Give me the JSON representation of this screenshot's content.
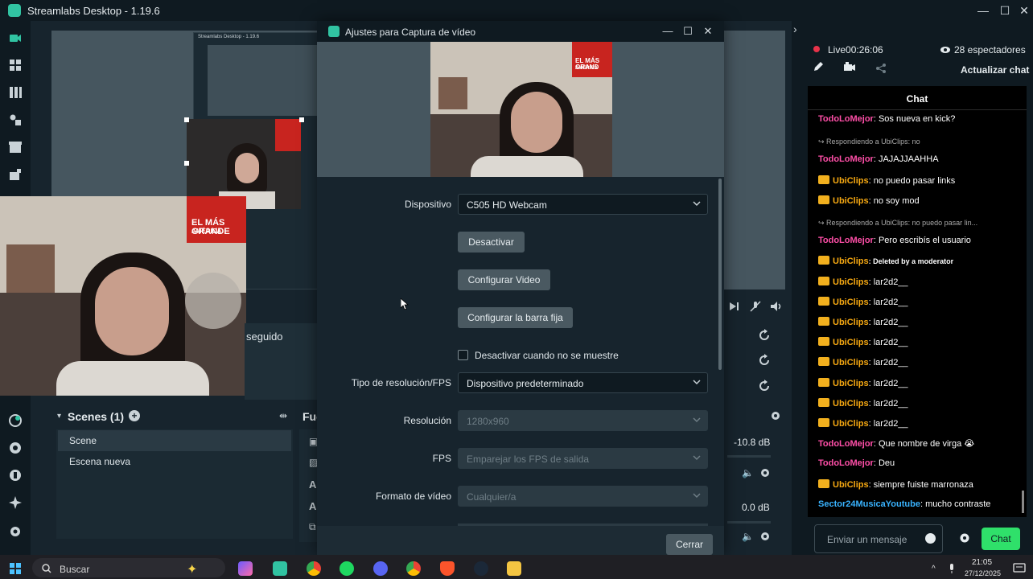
{
  "app": {
    "title": "Streamlabs Desktop - 1.19.6"
  },
  "nested": {
    "title": "Streamlabs Desktop - 1.19.6"
  },
  "preview": {
    "poster_lines": [
      "EL MÁS GRANDE",
      "DE",
      "AMÉRICA"
    ],
    "poster_top_lines": [
      "EL MÁS GRAND",
      "DE",
      "AMÉRICA"
    ]
  },
  "sources_partial": {
    "seguido_text": "seguido"
  },
  "scenes": {
    "title": "Scenes (1)",
    "items": [
      "Scene",
      "Escena nueva"
    ],
    "partial_next": "Fue"
  },
  "mixer": {
    "db1": "-10.8 dB",
    "db2": "0.0 dB"
  },
  "dialog": {
    "title": "Ajustes para Captura de vídeo",
    "fields": {
      "device_label": "Dispositivo",
      "device_value": "C505 HD Webcam",
      "resolution_type_label": "Tipo de resolución/FPS",
      "resolution_type_value": "Dispositivo predeterminado",
      "resolution_label": "Resolución",
      "resolution_value": "1280x960",
      "fps_label": "FPS",
      "fps_value": "Emparejar los FPS de salida",
      "format_label": "Formato de vídeo",
      "format_value": "Cualquier/a"
    },
    "buttons": {
      "deactivate": "Desactivar",
      "configure_video": "Configurar Video",
      "configure_bar": "Configurar la barra fija",
      "close": "Cerrar"
    },
    "checkbox_label": "Desactivar cuando no se muestre"
  },
  "live": {
    "status": "Live",
    "timer": "00:26:06",
    "viewers": "28 espectadores",
    "refresh_label": "Actualizar chat"
  },
  "chat": {
    "header": "Chat",
    "messages": [
      {
        "kind": "msg",
        "user": "TodoLoMejor",
        "color": "pink",
        "crown": false,
        "text": ": Sos nueva en kick?"
      },
      {
        "kind": "reply",
        "text": "↪ Respondiendo a UbiClips: no"
      },
      {
        "kind": "msg",
        "user": "TodoLoMejor",
        "color": "pink",
        "crown": false,
        "text": ": JAJAJJAAHHA"
      },
      {
        "kind": "msg",
        "user": "UbiClips",
        "color": "gold",
        "crown": true,
        "text": ": no puedo pasar links"
      },
      {
        "kind": "msg",
        "user": "UbiClips",
        "color": "gold",
        "crown": true,
        "text": ": no soy mod"
      },
      {
        "kind": "reply",
        "text": "↪ Respondiendo a UbiClips: no puedo pasar lin..."
      },
      {
        "kind": "msg",
        "user": "TodoLoMejor",
        "color": "pink",
        "crown": false,
        "text": ": Pero escribís el usuario"
      },
      {
        "kind": "msg",
        "user": "UbiClips",
        "color": "gold",
        "crown": true,
        "text": ": Deleted by a moderator",
        "small": true
      },
      {
        "kind": "msg",
        "user": "UbiClips",
        "color": "gold",
        "crown": true,
        "text": ": lar2d2__"
      },
      {
        "kind": "msg",
        "user": "UbiClips",
        "color": "gold",
        "crown": true,
        "text": ": lar2d2__"
      },
      {
        "kind": "msg",
        "user": "UbiClips",
        "color": "gold",
        "crown": true,
        "text": ": lar2d2__"
      },
      {
        "kind": "msg",
        "user": "UbiClips",
        "color": "gold",
        "crown": true,
        "text": ": lar2d2__"
      },
      {
        "kind": "msg",
        "user": "UbiClips",
        "color": "gold",
        "crown": true,
        "text": ": lar2d2__"
      },
      {
        "kind": "msg",
        "user": "UbiClips",
        "color": "gold",
        "crown": true,
        "text": ": lar2d2__"
      },
      {
        "kind": "msg",
        "user": "UbiClips",
        "color": "gold",
        "crown": true,
        "text": ": lar2d2__"
      },
      {
        "kind": "msg",
        "user": "UbiClips",
        "color": "gold",
        "crown": true,
        "text": ": lar2d2__"
      },
      {
        "kind": "msg",
        "user": "TodoLoMejor",
        "color": "pink",
        "crown": false,
        "text": ": Que nombre de virga 😭"
      },
      {
        "kind": "msg",
        "user": "TodoLoMejor",
        "color": "pink",
        "crown": false,
        "text": ": Deu"
      },
      {
        "kind": "msg",
        "user": "UbiClips",
        "color": "gold",
        "crown": true,
        "text": ": siempre fuiste marronaza"
      },
      {
        "kind": "msg",
        "user": "Sector24MusicaYoutube",
        "color": "blue",
        "crown": false,
        "text": ": mucho contraste"
      }
    ],
    "input_placeholder": "Enviar un mensaje",
    "send_label": "Chat"
  },
  "taskbar": {
    "search_label": "Buscar",
    "time": "21:05",
    "date": "27/12/2025"
  },
  "colors": {
    "accent": "#31c3a2",
    "live": "#e8334a",
    "user_pink": "#ff4fa8",
    "user_gold": "#f7a912",
    "user_blue": "#39b3ff",
    "chat_button": "#2fe06a"
  }
}
